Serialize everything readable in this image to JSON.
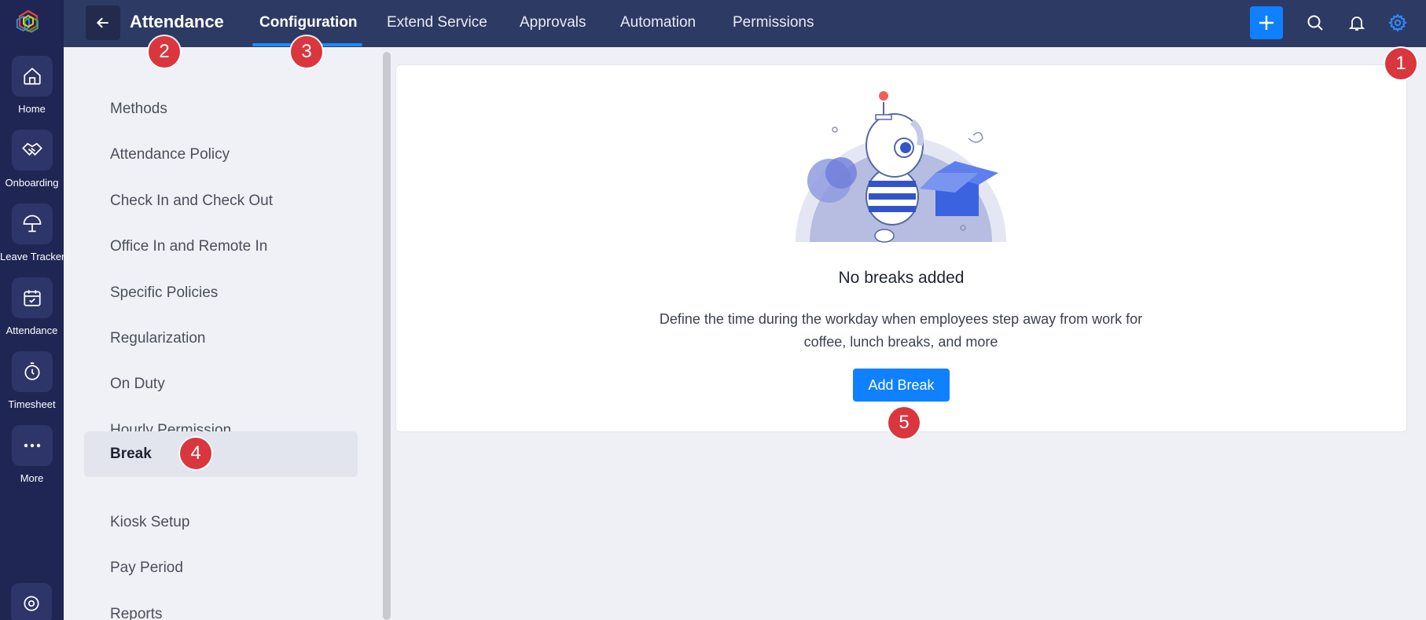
{
  "rail": {
    "items": [
      {
        "label": "Home",
        "icon": "home-icon"
      },
      {
        "label": "Onboarding",
        "icon": "handshake-icon"
      },
      {
        "label": "Leave Tracker",
        "icon": "umbrella-icon"
      },
      {
        "label": "Attendance",
        "icon": "calendar-check-icon"
      },
      {
        "label": "Timesheet",
        "icon": "timer-icon"
      },
      {
        "label": "More",
        "icon": "more-dots-icon"
      }
    ]
  },
  "topbar": {
    "module_title": "Attendance",
    "tabs": [
      {
        "label": "Configuration",
        "active": true
      },
      {
        "label": "Extend Service"
      },
      {
        "label": "Approvals"
      },
      {
        "label": "Automation"
      },
      {
        "label": "Permissions"
      }
    ]
  },
  "settings_nav": {
    "items": [
      {
        "label": "Methods"
      },
      {
        "label": "Attendance Policy"
      },
      {
        "label": "Check In and Check Out"
      },
      {
        "label": "Office In and Remote In"
      },
      {
        "label": "Specific Policies"
      },
      {
        "label": "Regularization"
      },
      {
        "label": "On Duty"
      },
      {
        "label": "Hourly Permission"
      },
      {
        "label": "Break",
        "active": true
      },
      {
        "label": "Kiosk Setup"
      },
      {
        "label": "Pay Period"
      },
      {
        "label": "Reports"
      }
    ]
  },
  "empty_state": {
    "title": "No breaks added",
    "description": "Define the time during the workday when employees step away from work for coffee, lunch breaks, and more",
    "button_label": "Add Break"
  },
  "badges": [
    "1",
    "2",
    "3",
    "4",
    "5"
  ],
  "colors": {
    "rail_bg": "#1f2654",
    "topbar_bg": "#2d3a63",
    "accent": "#0f80ff",
    "badge": "#d9363e"
  }
}
